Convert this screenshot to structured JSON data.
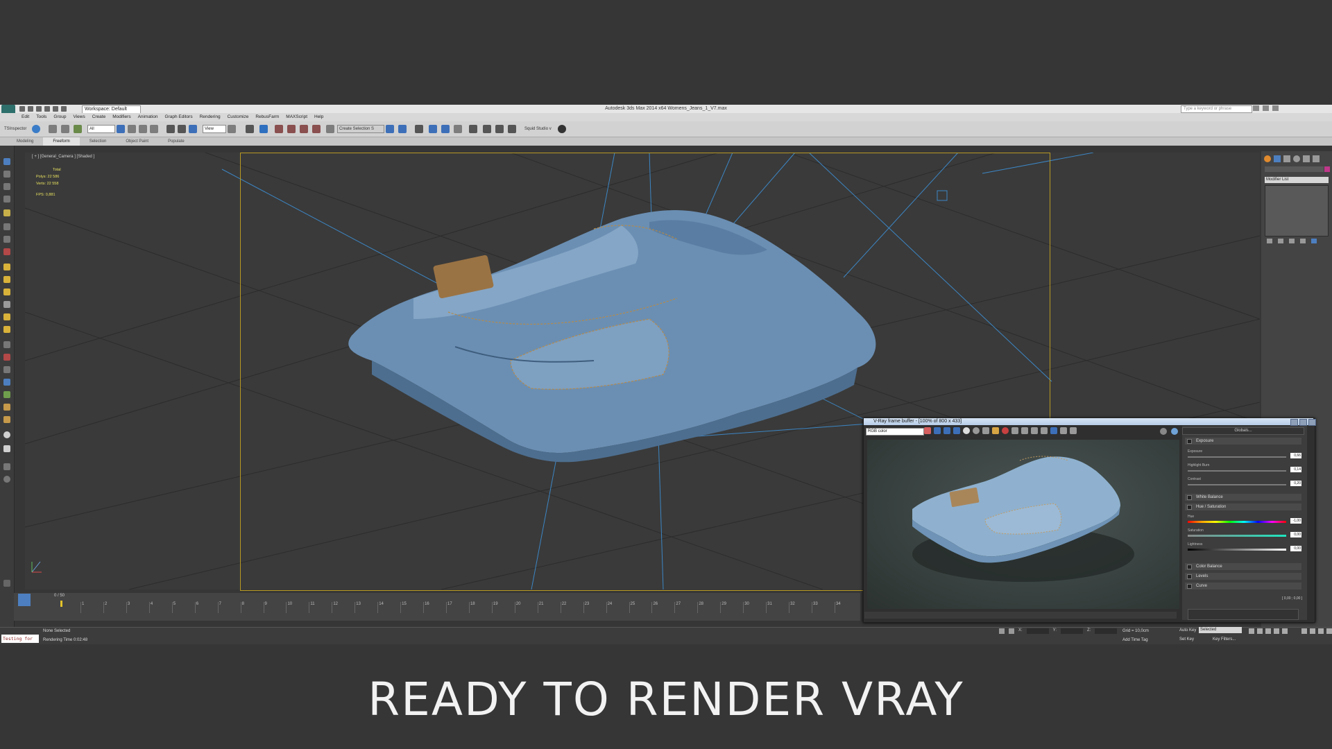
{
  "app": {
    "window_title": "Autodesk 3ds Max  2014 x64    Womens_Jeans_1_V7.max",
    "workspace": "Workspace: Default",
    "search_placeholder": "Type a keyword or phrase"
  },
  "menu": [
    "Edit",
    "Tools",
    "Group",
    "Views",
    "Create",
    "Modifiers",
    "Animation",
    "Graph Editors",
    "Rendering",
    "Customize",
    "RebusFarm",
    "MAXScript",
    "Help"
  ],
  "toolbar": {
    "tsinspector": "TSInspector",
    "filter_all": "All",
    "ref_coord": "View",
    "selection_set": "Create Selection S",
    "squid": "Squid Studio v"
  },
  "ribbon_tabs": [
    {
      "label": "Modeling",
      "active": false
    },
    {
      "label": "Freeform",
      "active": true
    },
    {
      "label": "Selection",
      "active": false
    },
    {
      "label": "Object Paint",
      "active": false
    },
    {
      "label": "Populate",
      "active": false
    }
  ],
  "viewport": {
    "label": "[ + ] [General_Camera ] [Shaded ]",
    "stats_header": "Total",
    "polys_label": "Polys:",
    "polys_value": "22 586",
    "verts_label": "Verts:",
    "verts_value": "22 558",
    "fps_label": "FPS:",
    "fps_value": "0,881"
  },
  "command_panel": {
    "modifier_list": "Modifier List"
  },
  "timeline": {
    "slider_label": "0 / 50",
    "ticks": [
      "0",
      "1",
      "2",
      "3",
      "4",
      "5",
      "6",
      "7",
      "8",
      "9",
      "10",
      "11",
      "12",
      "13",
      "14",
      "15",
      "16",
      "17",
      "18",
      "19",
      "20",
      "21",
      "22",
      "23",
      "24",
      "25",
      "26",
      "27",
      "28",
      "29",
      "30",
      "31",
      "32",
      "33",
      "34"
    ]
  },
  "status": {
    "maxscript_text": "Testing for",
    "selection": "None Selected",
    "render_time": "Rendering Time  0:02:48",
    "x_label": "X:",
    "y_label": "Y:",
    "z_label": "Z:",
    "grid": "Grid = 10,0cm",
    "add_time_tag": "Add Time Tag",
    "auto_key": "Auto Key",
    "selected": "Selected",
    "set_key": "Set Key",
    "key_filters": "Key Filters..."
  },
  "vfb": {
    "title": "V-Ray frame buffer - [100% of 800 x 433]",
    "channel": "RGB color",
    "globals": "Globals...",
    "sections": {
      "exposure": "Exposure",
      "white_balance": "White Balance",
      "hue_saturation": "Hue / Saturation",
      "color_balance": "Color Balance",
      "levels": "Levels",
      "curve": "Curve"
    },
    "sliders": {
      "exposure_label": "Exposure",
      "exposure_value": "0,66",
      "highlight_label": "Highlight Burn",
      "highlight_value": "0,14",
      "contrast_label": "Contrast",
      "contrast_value": "0,20",
      "hue_label": "Hue",
      "hue_value": "-1,00",
      "saturation_label": "Saturation",
      "saturation_value": "0,00",
      "lightness_label": "Lightness",
      "lightness_value": "0,00"
    },
    "curve_value": "[ 0,00 ; 0,00 ]"
  },
  "caption": "READY TO RENDER  VRAY",
  "colors": {
    "accent_gold": "#b99a22",
    "stats_yellow": "#e8e25e",
    "denim": "#6d92b8"
  }
}
